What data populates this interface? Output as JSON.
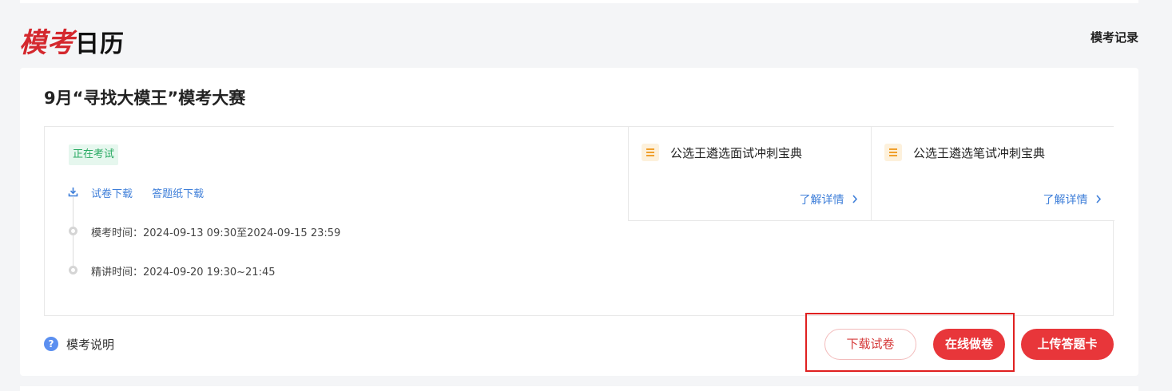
{
  "header": {
    "logo_red": "模考",
    "logo_black": "日历",
    "records_link": "模考记录"
  },
  "exam": {
    "title": "9月“寻找大模王”模考大赛",
    "status": "正在考试",
    "download_paper": "试卷下载",
    "download_answer_sheet": "答题纸下载",
    "exam_time": "模考时间：2024-09-13 09:30至2024-09-15 23:59",
    "lecture_time": "精讲时间：2024-09-20 19:30~21:45",
    "promos": [
      {
        "title": "公选王遴选面试冲刺宝典",
        "more": "了解详情"
      },
      {
        "title": "公选王遴选笔试冲刺宝典",
        "more": "了解详情"
      }
    ],
    "help_text": "模考说明",
    "buttons": {
      "download": "下载试卷",
      "online": "在线做卷",
      "upload": "上传答题卡"
    }
  },
  "colors": {
    "brand_red": "#e8363a",
    "link_blue": "#3f7fd9",
    "status_green": "#2aaa63"
  }
}
